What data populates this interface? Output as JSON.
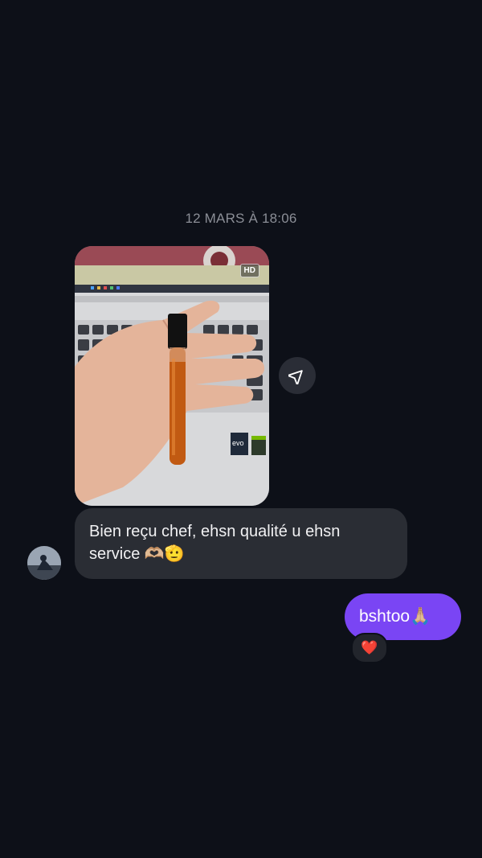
{
  "conversation": {
    "timestamp": "12 MARS À 18:06"
  },
  "media": {
    "badge": "HD",
    "share_icon": "paper-plane-icon"
  },
  "messages": {
    "incoming_text": "Bien reçu chef, ehsn qualité u ehsn service 🫶🏼🫡",
    "outgoing_text": "bshtoo🙏🏼",
    "reaction": "❤️"
  },
  "colors": {
    "background": "#0d1018",
    "incoming_bubble": "#2a2d34",
    "outgoing_bubble": "#7a45f4",
    "timestamp": "#8b8e96"
  }
}
